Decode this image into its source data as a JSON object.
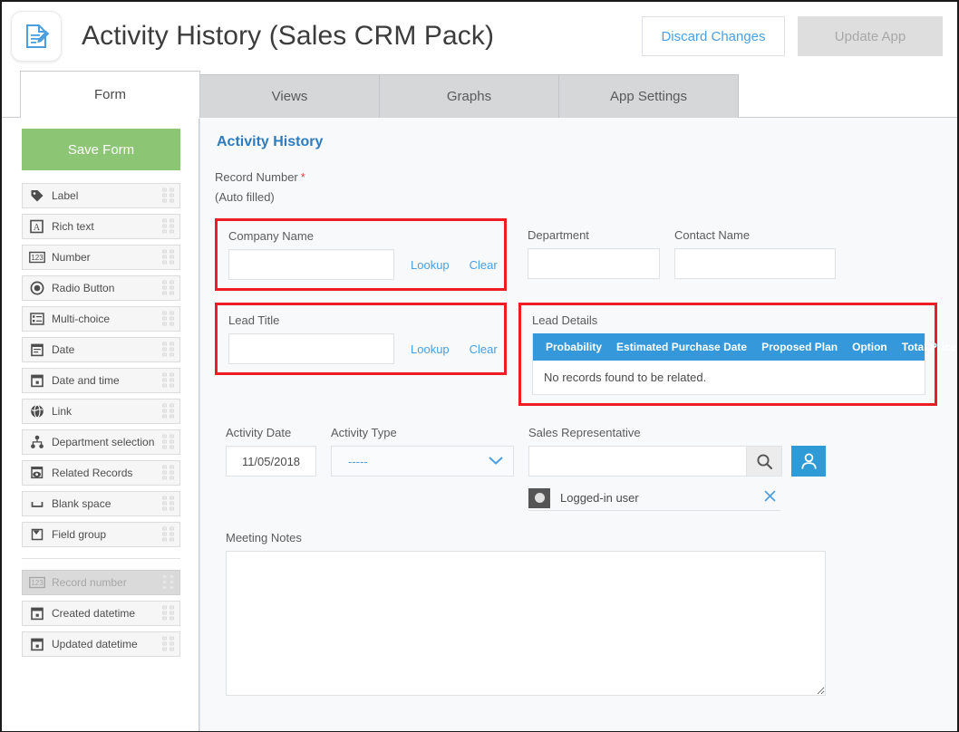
{
  "header": {
    "app_icon": "document-edit-icon",
    "title": "Activity History (Sales CRM Pack)",
    "discard_label": "Discard Changes",
    "update_label": "Update App"
  },
  "tabs": [
    {
      "label": "Form",
      "active": true
    },
    {
      "label": "Views",
      "active": false
    },
    {
      "label": "Graphs",
      "active": false
    },
    {
      "label": "App Settings",
      "active": false
    }
  ],
  "sidebar": {
    "save_form_label": "Save Form",
    "items": [
      {
        "label": "Label",
        "icon": "tag-icon",
        "disabled": false
      },
      {
        "label": "Rich text",
        "icon": "rich-text-icon",
        "disabled": false
      },
      {
        "label": "Number",
        "icon": "number-123-icon",
        "disabled": false
      },
      {
        "label": "Radio Button",
        "icon": "radio-button-icon",
        "disabled": false
      },
      {
        "label": "Multi-choice",
        "icon": "multi-choice-icon",
        "disabled": false
      },
      {
        "label": "Date",
        "icon": "calendar-icon",
        "disabled": false
      },
      {
        "label": "Date and time",
        "icon": "calendar-clock-icon",
        "disabled": false
      },
      {
        "label": "Link",
        "icon": "globe-link-icon",
        "disabled": false
      },
      {
        "label": "Department selection",
        "icon": "org-tree-icon",
        "disabled": false
      },
      {
        "label": "Related Records",
        "icon": "related-records-icon",
        "disabled": false
      },
      {
        "label": "Blank space",
        "icon": "blank-space-icon",
        "disabled": false
      },
      {
        "label": "Field group",
        "icon": "field-group-icon",
        "disabled": false
      }
    ],
    "system_items": [
      {
        "label": "Record number",
        "icon": "number-123-icon",
        "disabled": true
      },
      {
        "label": "Created datetime",
        "icon": "calendar-clock-icon",
        "disabled": false
      },
      {
        "label": "Updated datetime",
        "icon": "calendar-clock-icon",
        "disabled": false
      }
    ]
  },
  "form": {
    "title": "Activity History",
    "record_number": {
      "label": "Record Number",
      "required_mark": "*",
      "value_note": "(Auto filled)"
    },
    "company_name": {
      "label": "Company Name",
      "value": "",
      "lookup_label": "Lookup",
      "clear_label": "Clear",
      "highlighted": true
    },
    "department": {
      "label": "Department",
      "value": ""
    },
    "contact_name": {
      "label": "Contact Name",
      "value": ""
    },
    "lead_title": {
      "label": "Lead Title",
      "value": "",
      "lookup_label": "Lookup",
      "clear_label": "Clear",
      "highlighted": true
    },
    "lead_details": {
      "label": "Lead Details",
      "highlighted": true,
      "columns": [
        "Probability",
        "Estimated Purchase Date",
        "Proposed Plan",
        "Option",
        "Total Price"
      ],
      "empty_message": "No records found to be related."
    },
    "activity_date": {
      "label": "Activity Date",
      "value": "11/05/2018"
    },
    "activity_type": {
      "label": "Activity Type",
      "value": "-----"
    },
    "sales_representative": {
      "label": "Sales Representative",
      "value": "",
      "search_icon": "magnifier-icon",
      "user_picker_icon": "person-icon",
      "chip_label": "Logged-in user",
      "chip_remove_icon": "close-x-icon"
    },
    "meeting_notes": {
      "label": "Meeting Notes",
      "value": ""
    }
  },
  "colors": {
    "accent_blue": "#4b9fe0",
    "table_header_blue": "#3498db",
    "save_green": "#8cc573",
    "highlight_red": "#ee1c25",
    "required_red": "#e8453c",
    "canvas_bg": "#f7f9fb"
  }
}
